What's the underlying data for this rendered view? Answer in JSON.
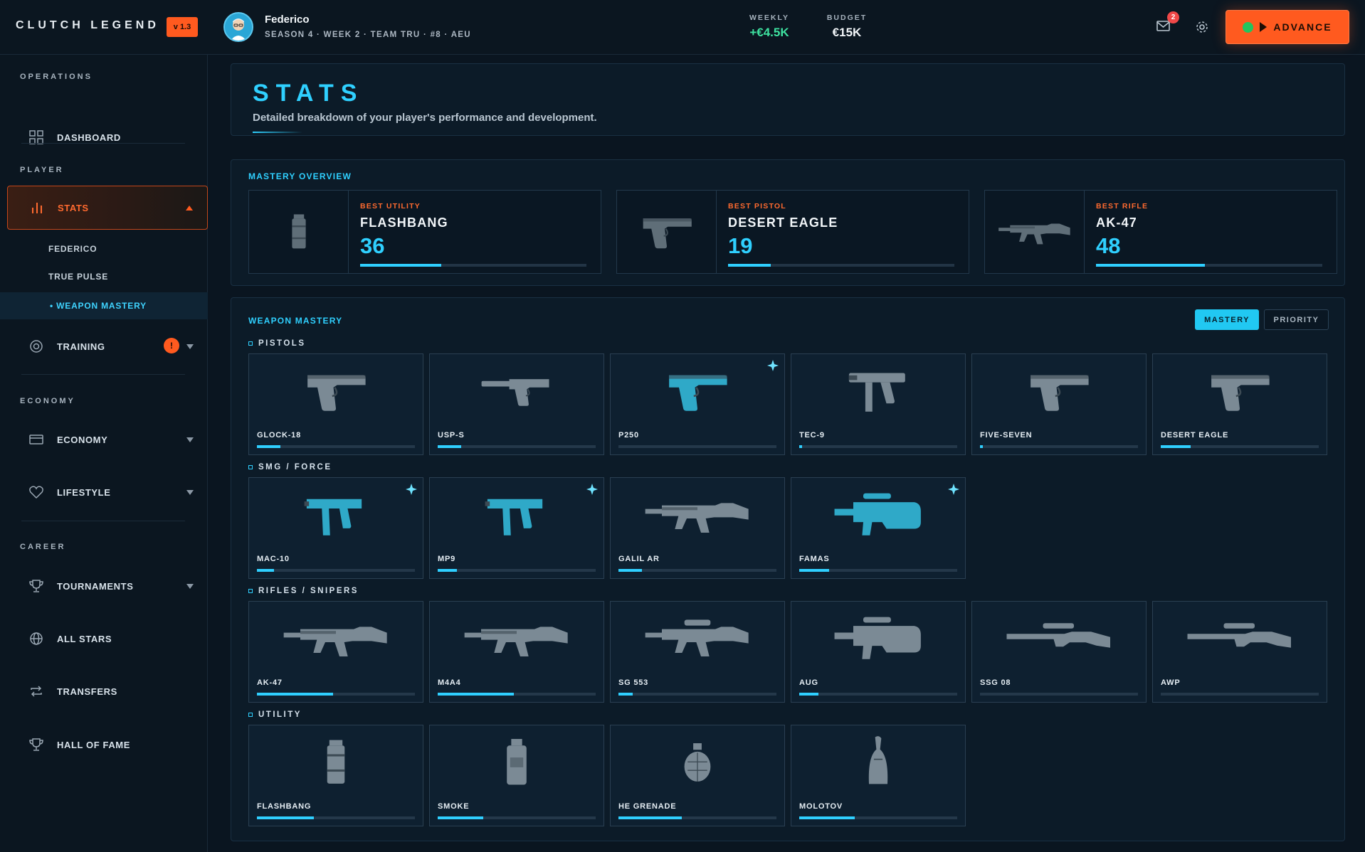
{
  "app": {
    "brand": "CLUTCH LEGEND",
    "version": "v 1.3"
  },
  "player": {
    "name": "Federico",
    "subtitle": "SEASON 4 · WEEK 2 · TEAM TRU · #8 · AEU"
  },
  "finance": {
    "weekly_label": "WEEKLY",
    "weekly_value": "+€4.5K",
    "budget_label": "BUDGET",
    "budget_value": "€15K"
  },
  "notifications": {
    "mail_count": "2"
  },
  "advance_label": "ADVANCE",
  "colors": {
    "accent": "#2fd0ff",
    "brand": "#ff5a1f",
    "positive": "#3ee2a0",
    "panel": "#0c1b28"
  },
  "sidebar": {
    "sections": [
      "OPERATIONS",
      "PLAYER",
      "ECONOMY",
      "CAREER"
    ],
    "items": {
      "dashboard": "DASHBOARD",
      "stats": "STATS",
      "training": "TRAINING",
      "economy": "ECONOMY",
      "lifestyle": "LIFESTYLE",
      "tournaments": "TOURNAMENTS",
      "all_stars": "ALL STARS",
      "transfers": "TRANSFERS",
      "hall_of_fame": "HALL OF FAME"
    },
    "stats_sub": [
      "FEDERICO",
      "TRUE PULSE",
      "• WEAPON MASTERY"
    ],
    "training_badge": "!"
  },
  "page": {
    "title": "STATS",
    "description": "Detailed breakdown of your player's performance and development."
  },
  "mastery_overview": {
    "title": "MASTERY OVERVIEW",
    "cards": [
      {
        "category": "BEST UTILITY",
        "weapon": "FLASHBANG",
        "value": "36",
        "progress": 0.36,
        "icon": "grenade-icon"
      },
      {
        "category": "BEST PISTOL",
        "weapon": "DESERT EAGLE",
        "value": "19",
        "progress": 0.19,
        "icon": "pistol-icon"
      },
      {
        "category": "BEST RIFLE",
        "weapon": "AK-47",
        "value": "48",
        "progress": 0.48,
        "icon": "rifle-icon"
      }
    ]
  },
  "weapon_mastery": {
    "title": "WEAPON MASTERY",
    "toggle": {
      "mastery": "MASTERY",
      "priority": "PRIORITY"
    },
    "groups": [
      {
        "label": "PISTOLS",
        "weapons": [
          {
            "name": "GLOCK-18",
            "progress": 0.15,
            "icon": "pistol-icon",
            "featured": false
          },
          {
            "name": "USP-S",
            "progress": 0.15,
            "icon": "silenced-pistol-icon",
            "featured": false
          },
          {
            "name": "P250",
            "progress": 0.0,
            "icon": "pistol-icon",
            "featured": true
          },
          {
            "name": "TEC-9",
            "progress": 0.02,
            "icon": "machine-pistol-icon",
            "featured": false
          },
          {
            "name": "FIVE-SEVEN",
            "progress": 0.02,
            "icon": "pistol-icon",
            "featured": false
          },
          {
            "name": "DESERT EAGLE",
            "progress": 0.19,
            "icon": "pistol-icon",
            "featured": false
          }
        ]
      },
      {
        "label": "SMG / FORCE",
        "weapons": [
          {
            "name": "MAC-10",
            "progress": 0.11,
            "icon": "smg-icon",
            "featured": true
          },
          {
            "name": "MP9",
            "progress": 0.12,
            "icon": "smg-icon",
            "featured": true
          },
          {
            "name": "GALIL AR",
            "progress": 0.15,
            "icon": "rifle-icon",
            "featured": false
          },
          {
            "name": "FAMAS",
            "progress": 0.19,
            "icon": "bullpup-icon",
            "featured": true
          }
        ]
      },
      {
        "label": "RIFLES / SNIPERS",
        "weapons": [
          {
            "name": "AK-47",
            "progress": 0.48,
            "icon": "rifle-icon",
            "featured": false
          },
          {
            "name": "M4A4",
            "progress": 0.48,
            "icon": "rifle-icon",
            "featured": false
          },
          {
            "name": "SG 553",
            "progress": 0.09,
            "icon": "scoped-rifle-icon",
            "featured": false
          },
          {
            "name": "AUG",
            "progress": 0.12,
            "icon": "bullpup-icon",
            "featured": false
          },
          {
            "name": "SSG 08",
            "progress": 0.0,
            "icon": "sniper-icon",
            "featured": false
          },
          {
            "name": "AWP",
            "progress": 0.0,
            "icon": "sniper-icon",
            "featured": false
          }
        ]
      },
      {
        "label": "UTILITY",
        "weapons": [
          {
            "name": "FLASHBANG",
            "progress": 0.36,
            "icon": "grenade-icon",
            "featured": false
          },
          {
            "name": "SMOKE",
            "progress": 0.29,
            "icon": "smoke-grenade-icon",
            "featured": false
          },
          {
            "name": "HE GRENADE",
            "progress": 0.4,
            "icon": "frag-grenade-icon",
            "featured": false
          },
          {
            "name": "MOLOTOV",
            "progress": 0.35,
            "icon": "molotov-icon",
            "featured": false
          }
        ]
      }
    ]
  }
}
